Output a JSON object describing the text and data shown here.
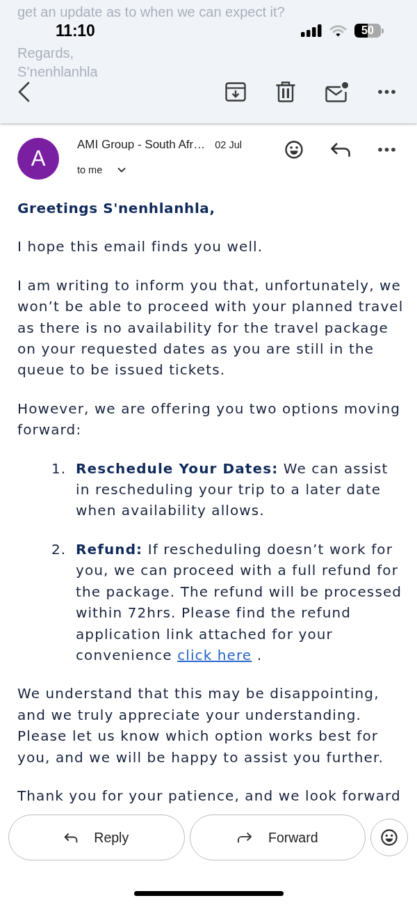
{
  "background_text": [
    "get an update as to when we can expect it?",
    "Regards,",
    "S’nenhlanhla"
  ],
  "status_bar": {
    "time": "11:10",
    "battery": {
      "text": "50",
      "level": 0.5
    }
  },
  "message": {
    "avatar_letter": "A",
    "sender": "AMI Group - South Afr…",
    "date": "02 Jul",
    "recipient": "to me"
  },
  "body": [
    {
      "kind": "greeting",
      "text": "Greetings S'nenhlanhla,"
    },
    {
      "kind": "paragraph",
      "text": "I hope this email finds you well."
    },
    {
      "kind": "paragraph",
      "text": "I am writing to inform you that, unfortunately, we won’t be able to proceed with your planned travel as there is no availability for the travel package on your requested dates as you are still in the queue to be issued tickets."
    },
    {
      "kind": "paragraph",
      "text": "However, we are offering you two options moving forward:"
    },
    {
      "kind": "list",
      "items": [
        {
          "number": "1.",
          "text": "**Reschedule Your Dates:** We can assist in rescheduling your trip to a later date when availability allows."
        },
        {
          "number": "2.",
          "text": "**Refund:** If rescheduling doesn’t work for you, we can proceed with a full refund for the package. The refund will be processed within 72hrs. Please find the refund application link attached for your convenience",
          "link": "click here",
          "after": "."
        }
      ]
    },
    {
      "kind": "paragraph",
      "text": "We understand that this may be disappointing, and we truly appreciate your understanding. Please let us know which option works best for you, and we will be happy to assist you further."
    },
    {
      "kind": "paragraph",
      "text": "Thank you for your patience, and we look forward"
    }
  ],
  "actions": [
    {
      "kind": "reply",
      "label": "Reply"
    },
    {
      "kind": "forward",
      "label": "Forward"
    }
  ]
}
